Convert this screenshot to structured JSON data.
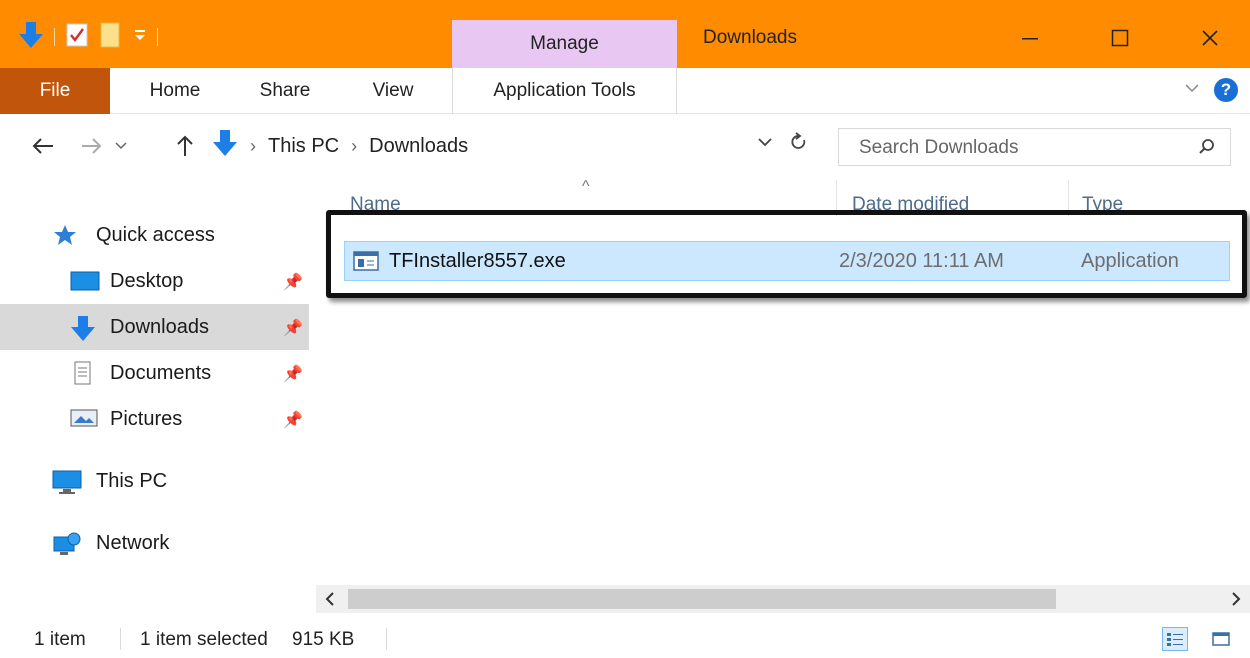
{
  "window": {
    "title": "Downloads",
    "contextual_tab_group": "Manage",
    "quick_access_toolbar": [
      "down-arrow-icon",
      "properties-icon",
      "new-folder-icon",
      "customize-dropdown-icon"
    ],
    "controls": [
      "minimize-icon",
      "maximize-icon",
      "close-icon"
    ]
  },
  "ribbon": {
    "tabs": [
      {
        "label": "File"
      },
      {
        "label": "Home"
      },
      {
        "label": "Share"
      },
      {
        "label": "View"
      },
      {
        "label": "Application Tools"
      }
    ]
  },
  "address": {
    "breadcrumbs": [
      "This PC",
      "Downloads"
    ],
    "search_placeholder": "Search Downloads"
  },
  "nav_pane": {
    "items": [
      {
        "label": "Quick access",
        "icon": "star-icon"
      },
      {
        "label": "Desktop",
        "icon": "desktop-icon",
        "pinned": true
      },
      {
        "label": "Downloads",
        "icon": "download-arrow-icon",
        "pinned": true,
        "selected": true
      },
      {
        "label": "Documents",
        "icon": "document-icon",
        "pinned": true
      },
      {
        "label": "Pictures",
        "icon": "pictures-icon",
        "pinned": true
      },
      {
        "label": "This PC",
        "icon": "computer-icon"
      },
      {
        "label": "Network",
        "icon": "network-icon"
      }
    ]
  },
  "file_list": {
    "columns": [
      "Name",
      "Date modified",
      "Type"
    ],
    "rows": [
      {
        "name": "TFInstaller8557.exe",
        "date_modified": "2/3/2020 11:11 AM",
        "type": "Application",
        "selected": true
      }
    ]
  },
  "status_bar": {
    "item_count": "1 item",
    "selection": "1 item selected",
    "size": "915 KB"
  },
  "colors": {
    "titlebar": "#ff8c00",
    "file_tab": "#c0550b",
    "manage_tab": "#e9c7f3",
    "selection": "#cce8ff",
    "nav_selected": "#d9d9d9"
  }
}
